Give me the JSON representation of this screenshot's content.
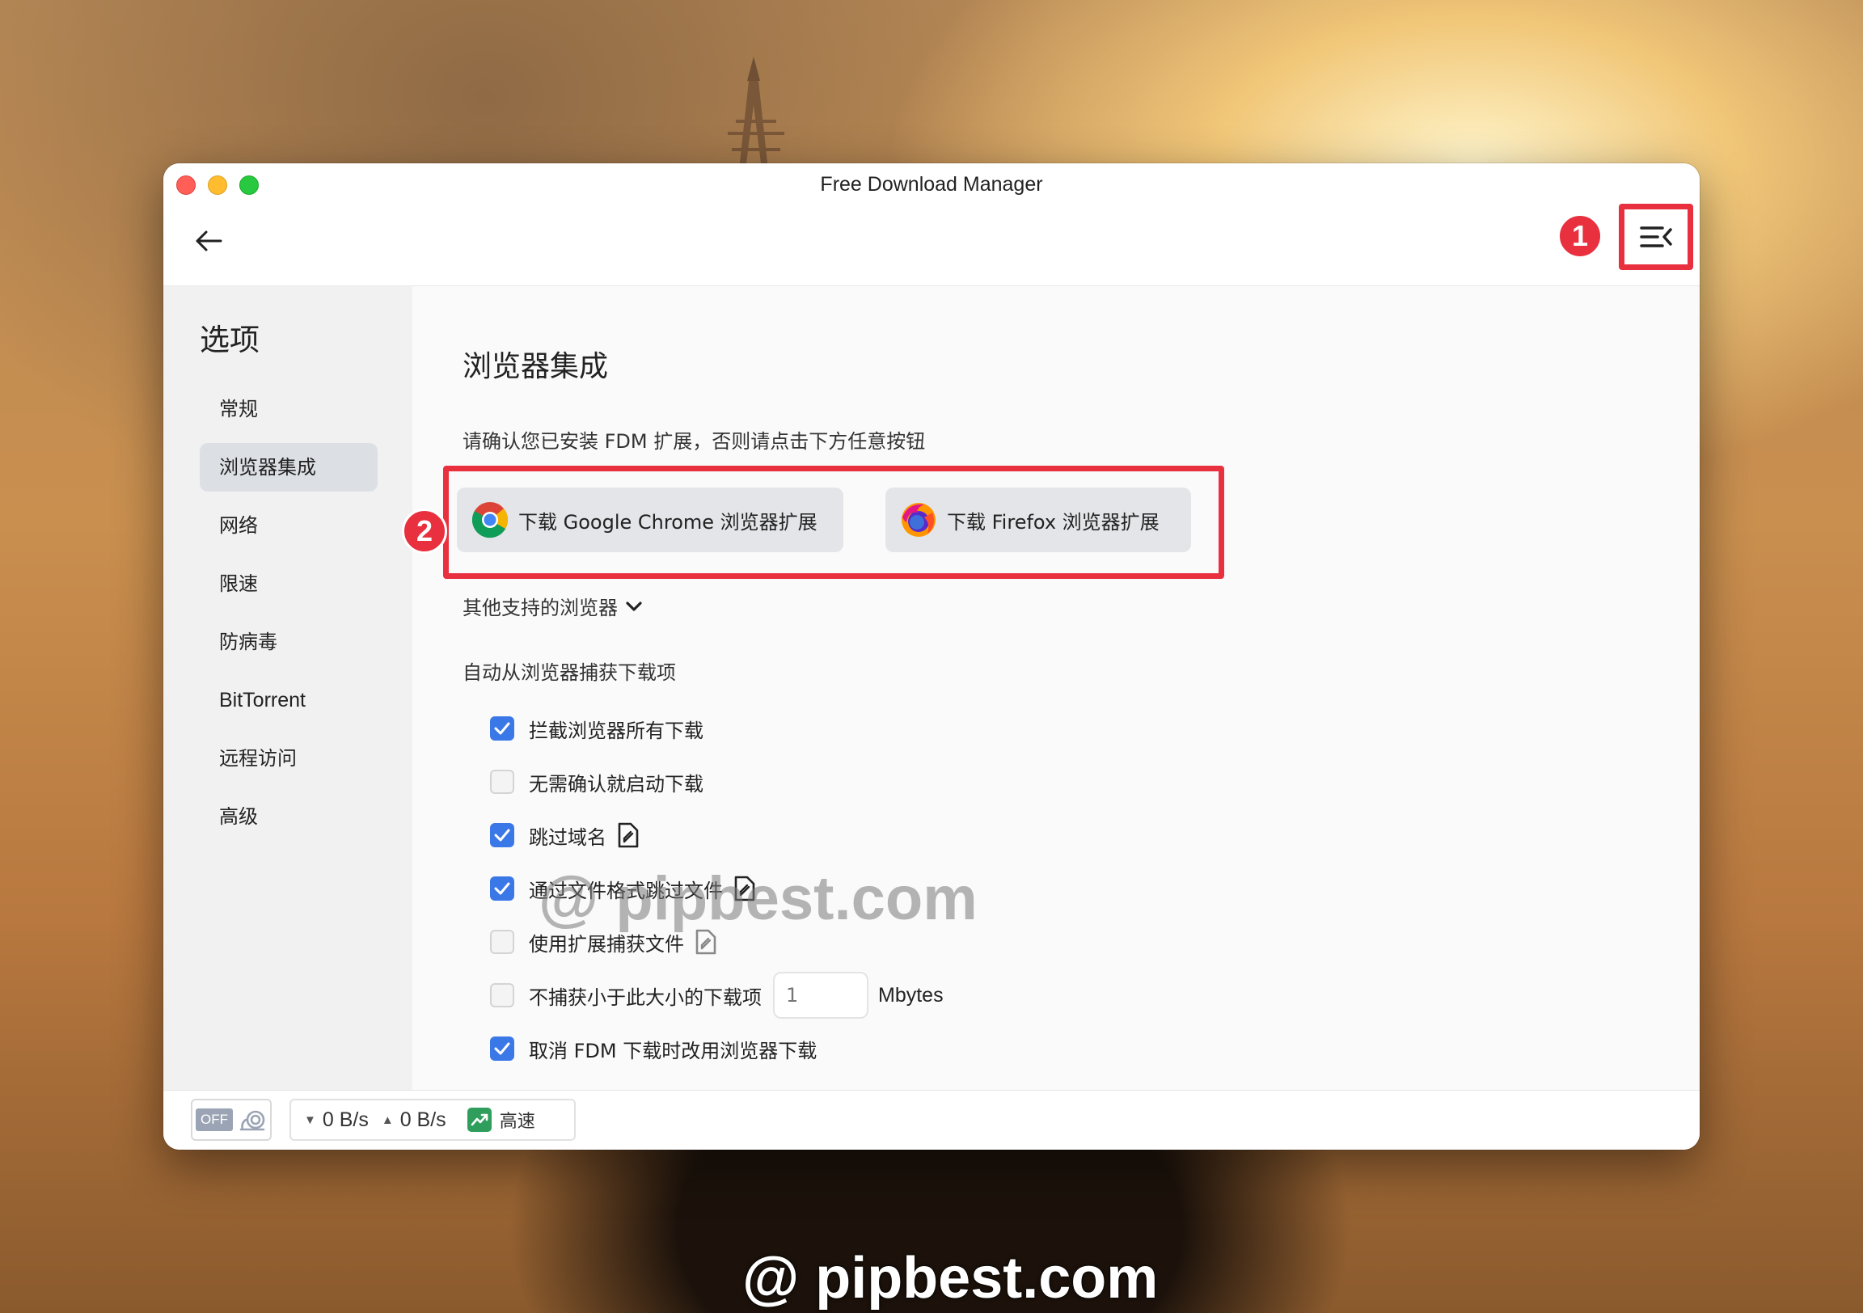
{
  "window": {
    "title": "Free Download Manager",
    "annotation_1": "1",
    "annotation_2": "2"
  },
  "sidebar": {
    "title": "选项",
    "items": [
      {
        "label": "常规",
        "active": false
      },
      {
        "label": "浏览器集成",
        "active": true
      },
      {
        "label": "网络",
        "active": false
      },
      {
        "label": "限速",
        "active": false
      },
      {
        "label": "防病毒",
        "active": false
      },
      {
        "label": "BitTorrent",
        "active": false
      },
      {
        "label": "远程访问",
        "active": false
      },
      {
        "label": "高级",
        "active": false
      }
    ]
  },
  "main": {
    "title": "浏览器集成",
    "hint": "请确认您已安装 FDM 扩展，否则请点击下方任意按钮",
    "chrome_button": "下载 Google Chrome 浏览器扩展",
    "firefox_button": "下载 Firefox 浏览器扩展",
    "other_browsers": "其他支持的浏览器",
    "auto_capture_title": "自动从浏览器捕获下载项",
    "options": [
      {
        "label": "拦截浏览器所有下载",
        "checked": true,
        "doc_icon": false
      },
      {
        "label": "无需确认就启动下载",
        "checked": false,
        "doc_icon": false
      },
      {
        "label": "跳过域名",
        "checked": true,
        "doc_icon": true
      },
      {
        "label": "通过文件格式跳过文件",
        "checked": true,
        "doc_icon": true
      },
      {
        "label": "使用扩展捕获文件",
        "checked": false,
        "doc_icon": true
      },
      {
        "label": "不捕获小于此大小的下载项",
        "checked": false,
        "doc_icon": false
      },
      {
        "label": "取消 FDM 下载时改用浏览器下载",
        "checked": true,
        "doc_icon": false
      }
    ],
    "min_size_placeholder": "1",
    "min_size_unit": "Mbytes"
  },
  "statusbar": {
    "off_label": "OFF",
    "download_speed": "0 B/s",
    "upload_speed": "0 B/s",
    "speed_mode": "高速"
  },
  "colors": {
    "accent_red": "#e8303f",
    "checkbox_blue": "#3b78e7",
    "speed_green": "#2f9e5c"
  },
  "watermark": "@ pipbest.com"
}
